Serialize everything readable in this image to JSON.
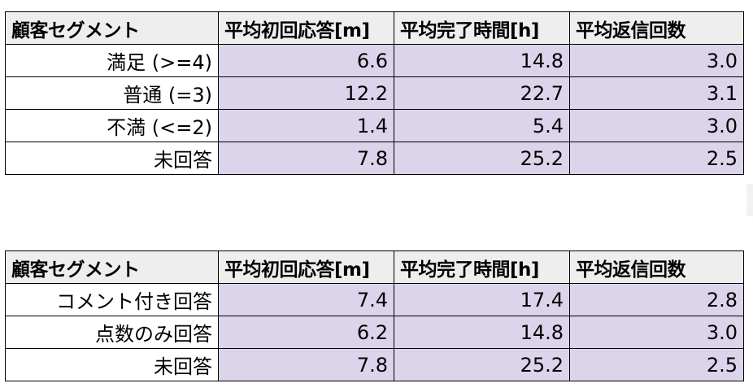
{
  "tables": [
    {
      "headers": [
        "顧客セグメント",
        "平均初回応答[m]",
        "平均完了時間[h]",
        "平均返信回数"
      ],
      "rows": [
        [
          "満足 (>=4)",
          "6.6",
          "14.8",
          "3.0"
        ],
        [
          "普通 (=3)",
          "12.2",
          "22.7",
          "3.1"
        ],
        [
          "不満 (<=2)",
          "1.4",
          "5.4",
          "3.0"
        ],
        [
          "未回答",
          "7.8",
          "25.2",
          "2.5"
        ]
      ]
    },
    {
      "headers": [
        "顧客セグメント",
        "平均初回応答[m]",
        "平均完了時間[h]",
        "平均返信回数"
      ],
      "rows": [
        [
          "コメント付き回答",
          "7.4",
          "17.4",
          "2.8"
        ],
        [
          "点数のみ回答",
          "6.2",
          "14.8",
          "3.0"
        ],
        [
          "未回答",
          "7.8",
          "25.2",
          "2.5"
        ]
      ]
    }
  ],
  "colors": {
    "header_bg": "#eeeeee",
    "value_cell_bg": "#dcd4ea",
    "border": "#000000"
  }
}
